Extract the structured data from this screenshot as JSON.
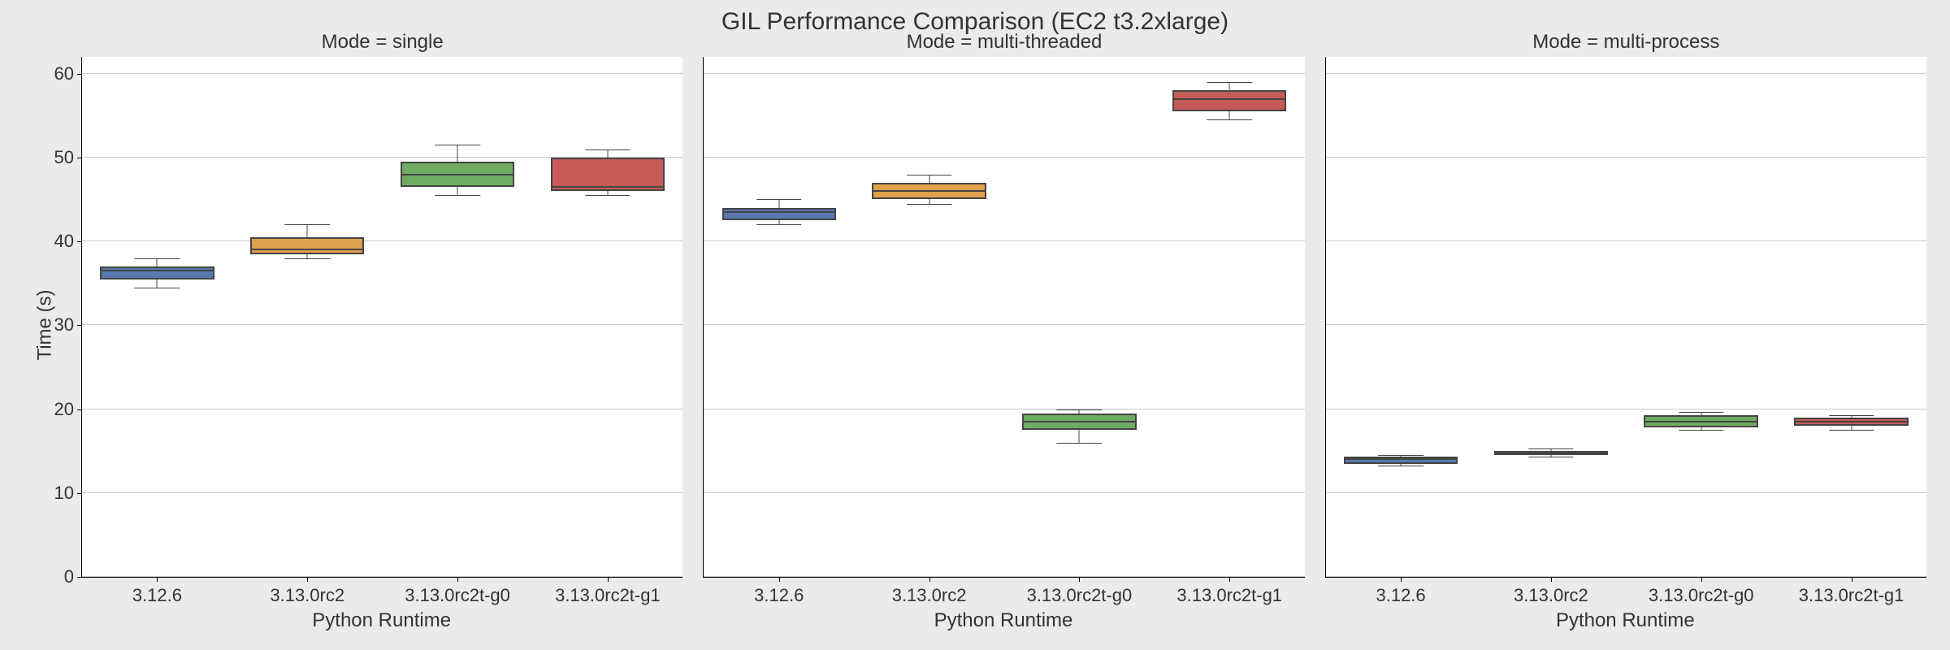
{
  "title": "GIL Performance Comparison (EC2 t3.2xlarge)",
  "ylabel": "Time (s)",
  "xlabel": "Python Runtime",
  "modes": [
    "single",
    "multi-threaded",
    "multi-process"
  ],
  "runtimes": [
    "3.12.6",
    "3.13.0rc2",
    "3.13.0rc2t-g0",
    "3.13.0rc2t-g1"
  ],
  "yticks": [
    0,
    10,
    20,
    30,
    40,
    50,
    60
  ],
  "ylim": [
    0,
    62
  ],
  "panel_titles": [
    "Mode = single",
    "Mode = multi-threaded",
    "Mode = multi-process"
  ],
  "colors": [
    "#5a78b0",
    "#e0a04f",
    "#6fab62",
    "#c55a57"
  ],
  "chart_data": [
    {
      "type": "boxplot",
      "mode": "single",
      "series": [
        {
          "name": "3.12.6",
          "q1": 35.5,
          "median": 36.5,
          "q3": 37.0,
          "whisker_lo": 34.5,
          "whisker_hi": 38.0
        },
        {
          "name": "3.13.0rc2",
          "q1": 38.5,
          "median": 39.0,
          "q3": 40.5,
          "whisker_lo": 38.0,
          "whisker_hi": 42.0
        },
        {
          "name": "3.13.0rc2t-g0",
          "q1": 46.5,
          "median": 48.0,
          "q3": 49.5,
          "whisker_lo": 45.5,
          "whisker_hi": 51.5
        },
        {
          "name": "3.13.0rc2t-g1",
          "q1": 46.0,
          "median": 46.5,
          "q3": 50.0,
          "whisker_lo": 45.5,
          "whisker_hi": 51.0
        }
      ]
    },
    {
      "type": "boxplot",
      "mode": "multi-threaded",
      "series": [
        {
          "name": "3.12.6",
          "q1": 42.5,
          "median": 43.5,
          "q3": 44.0,
          "whisker_lo": 42.0,
          "whisker_hi": 45.0
        },
        {
          "name": "3.13.0rc2",
          "q1": 45.0,
          "median": 46.0,
          "q3": 47.0,
          "whisker_lo": 44.5,
          "whisker_hi": 48.0
        },
        {
          "name": "3.13.0rc2t-g0",
          "q1": 17.5,
          "median": 18.5,
          "q3": 19.5,
          "whisker_lo": 16.0,
          "whisker_hi": 20.0
        },
        {
          "name": "3.13.0rc2t-g1",
          "q1": 55.5,
          "median": 57.0,
          "q3": 58.0,
          "whisker_lo": 54.5,
          "whisker_hi": 59.0
        }
      ]
    },
    {
      "type": "boxplot",
      "mode": "multi-process",
      "series": [
        {
          "name": "3.12.6",
          "q1": 13.5,
          "median": 14.0,
          "q3": 14.3,
          "whisker_lo": 13.3,
          "whisker_hi": 14.5
        },
        {
          "name": "3.13.0rc2",
          "q1": 14.5,
          "median": 14.8,
          "q3": 15.0,
          "whisker_lo": 14.3,
          "whisker_hi": 15.3
        },
        {
          "name": "3.13.0rc2t-g0",
          "q1": 17.8,
          "median": 18.5,
          "q3": 19.3,
          "whisker_lo": 17.5,
          "whisker_hi": 19.7
        },
        {
          "name": "3.13.0rc2t-g1",
          "q1": 18.0,
          "median": 18.5,
          "q3": 19.0,
          "whisker_lo": 17.5,
          "whisker_hi": 19.3
        }
      ]
    }
  ]
}
